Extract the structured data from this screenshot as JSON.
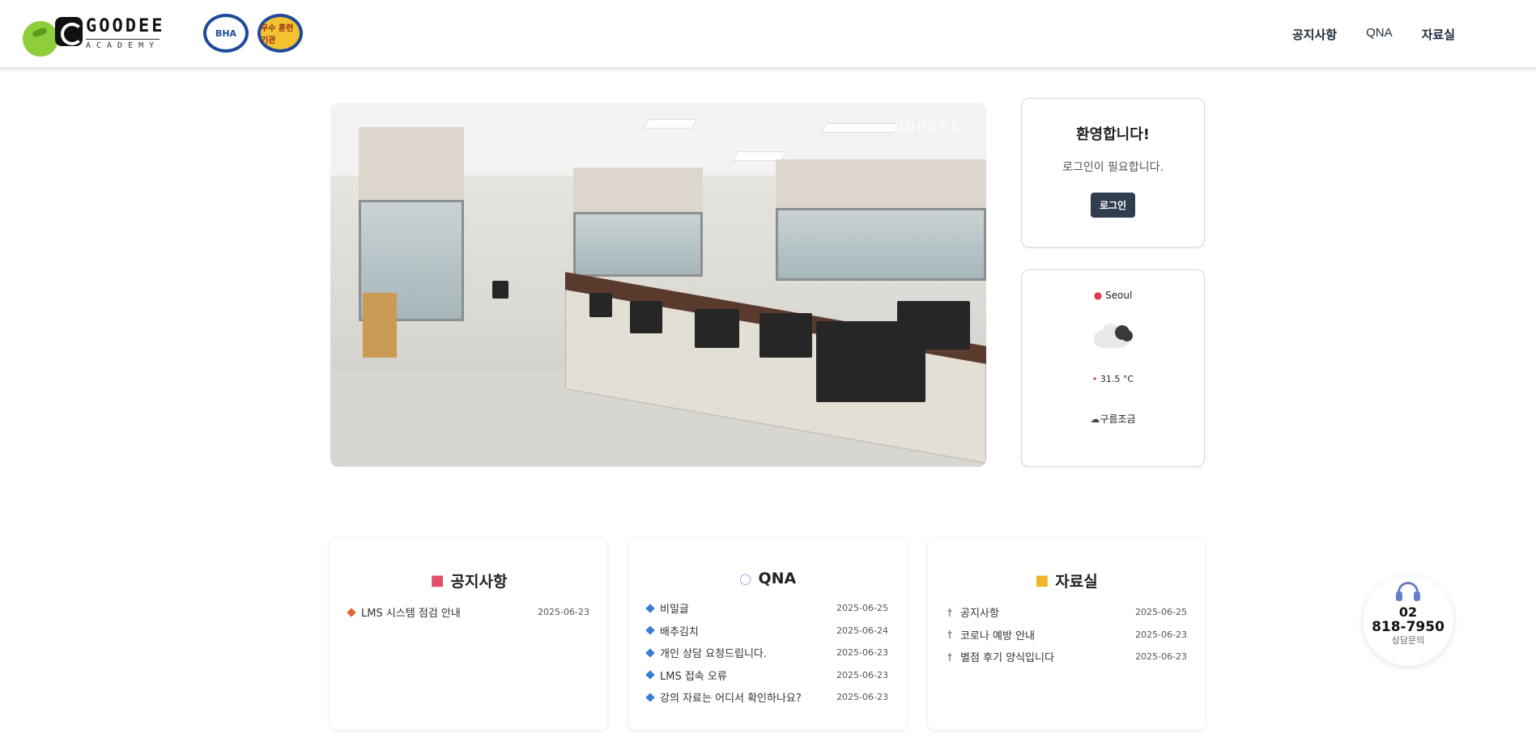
{
  "header": {
    "logo_text": "GOODEE",
    "logo_sub": "ACADEMY",
    "badges": [
      "BHA",
      "우수 훈련기관"
    ],
    "nav": [
      {
        "label": "공지사항"
      },
      {
        "label": "QNA"
      },
      {
        "label": "자료실"
      }
    ]
  },
  "hero": {
    "watermark": "GOODEE"
  },
  "welcome": {
    "title": "환영합니다!",
    "message": "로그인이 필요합니다.",
    "login_label": "로그인"
  },
  "weather": {
    "city": "Seoul",
    "temp": "31.5 °C",
    "description": "구름조금",
    "icon": "partly-cloudy-icon"
  },
  "panels": {
    "notice": {
      "title": "공지사항",
      "icon": "megaphone-icon",
      "items": [
        {
          "title": "LMS 시스템 점검 안내",
          "date": "2025-06-23"
        }
      ]
    },
    "qna": {
      "title": "QNA",
      "icon": "speech-bubble-icon",
      "items": [
        {
          "title": "비밀글",
          "date": "2025-06-25"
        },
        {
          "title": "배추김치",
          "date": "2025-06-24"
        },
        {
          "title": "개인 상담 요청드립니다.",
          "date": "2025-06-23"
        },
        {
          "title": "LMS 접속 오류",
          "date": "2025-06-23"
        },
        {
          "title": "강의 자료는 어디서 확인하나요?",
          "date": "2025-06-23"
        }
      ]
    },
    "files": {
      "title": "자료실",
      "icon": "folder-icon",
      "items": [
        {
          "title": "공지사항",
          "date": "2025-06-25"
        },
        {
          "title": "코로나 예방 안내",
          "date": "2025-06-23"
        },
        {
          "title": "별점 후기 양식입니다",
          "date": "2025-06-23"
        }
      ]
    }
  },
  "call": {
    "line1": "02",
    "line2": "818-7950",
    "label": "상담문의"
  },
  "colors": {
    "accent_dark": "#2f3e4e",
    "nav_text": "#1c2b3a",
    "notice_bullet": "#e2643a",
    "qna_bullet": "#3b7bd4"
  }
}
